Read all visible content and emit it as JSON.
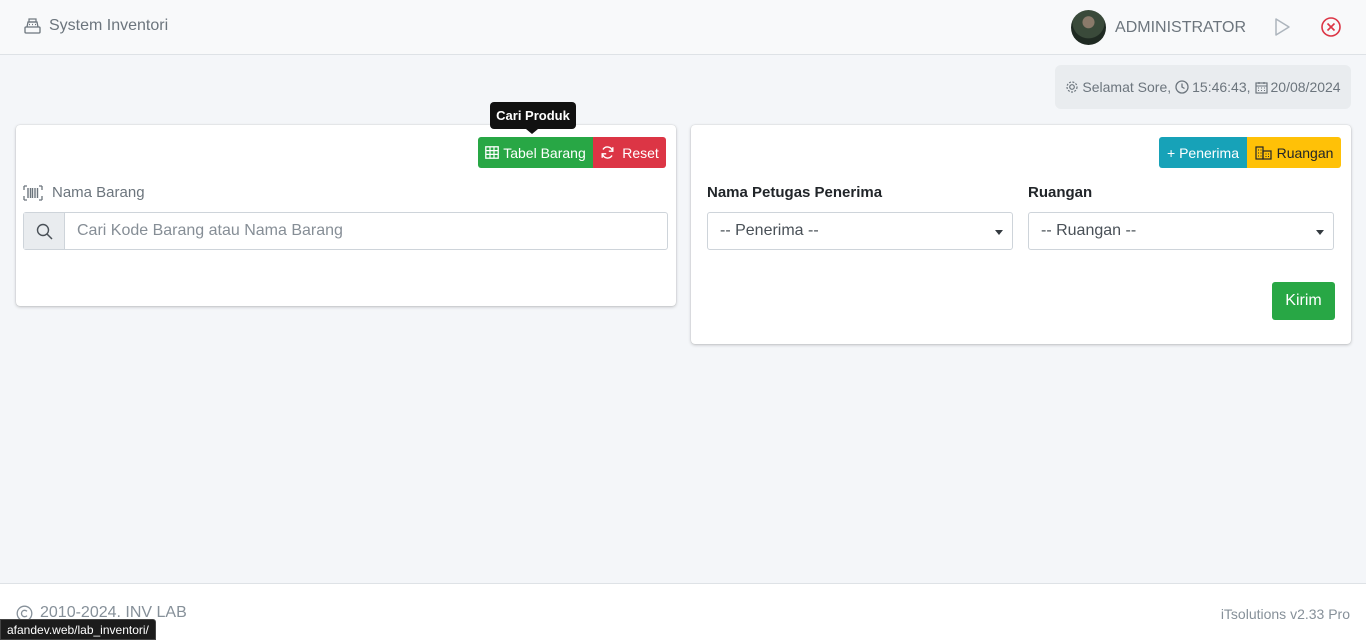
{
  "navbar": {
    "brand": "System Inventori",
    "user": "ADMINISTRATOR",
    "icons": [
      "cash-register-icon",
      "play-icon",
      "close-circle-icon"
    ]
  },
  "greeting": {
    "text": "Selamat Sore,",
    "time": "15:46:43,",
    "date": "20/08/2024"
  },
  "left_card": {
    "tooltip": "Cari Produk",
    "tabel_button": "Tabel Barang",
    "reset_button": "Reset",
    "field_label": "Nama Barang",
    "search_placeholder": "Cari Kode Barang atau Nama Barang"
  },
  "right_card": {
    "penerima_button": "+ Penerima",
    "ruangan_button": "Ruangan",
    "petugas_label": "Nama Petugas Penerima",
    "petugas_selected": "-- Penerima --",
    "ruangan_label": "Ruangan",
    "ruangan_selected": "-- Ruangan --",
    "submit_button": "Kirim"
  },
  "footer": {
    "copyright": "2010-2024. INV LAB",
    "version": "iTsolutions v2.33 Pro"
  },
  "statusbar": {
    "url": "afandev.web/lab_inventori/"
  },
  "colors": {
    "success": "#28a745",
    "danger": "#dc3545",
    "info": "#17a2b8",
    "warning": "#ffc107"
  }
}
